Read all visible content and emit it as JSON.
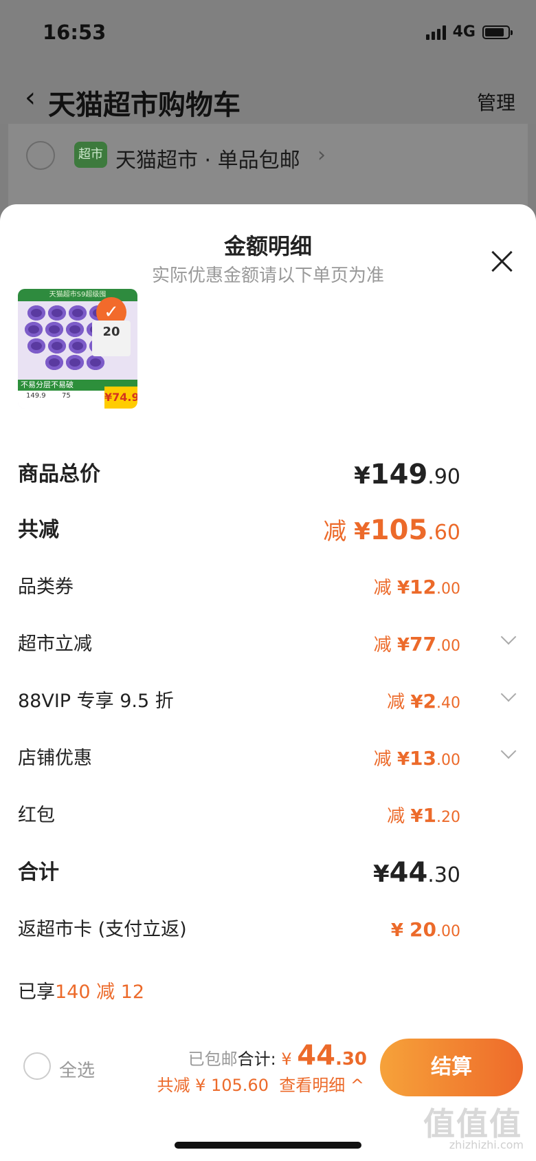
{
  "status_bar": {
    "time": "16:53",
    "network": "4G"
  },
  "nav": {
    "title": "天猫超市购物车",
    "manage": "管理"
  },
  "shop": {
    "badge": "超市",
    "name": "天猫超市 · 单品包邮"
  },
  "sheet": {
    "title": "金额明细",
    "subtitle": "实际优惠金额请以下单页为准",
    "product": {
      "banner": "天猫超市S9超级囤",
      "promo_line": "不易分层不易破",
      "original_price": "149.9",
      "discount_price": "75",
      "final_price": "¥74.9",
      "rebate": "20"
    },
    "rows": [
      {
        "label": "商品总价",
        "prefix": "",
        "yen": "¥",
        "int": "149",
        "dec": ".90",
        "style": "lg-dark",
        "chevron": false
      },
      {
        "label": "共减",
        "prefix": "减 ",
        "yen": "¥",
        "int": "105",
        "dec": ".60",
        "style": "lg-orange",
        "chevron": false
      },
      {
        "label": "品类券",
        "prefix": "减 ",
        "yen": "¥",
        "int": "12",
        "dec": ".00",
        "style": "md-orange",
        "chevron": false
      },
      {
        "label": "超市立减",
        "prefix": "减 ",
        "yen": "¥",
        "int": "77",
        "dec": ".00",
        "style": "md-orange",
        "chevron": true
      },
      {
        "label": "88VIP 专享 9.5 折",
        "prefix": "减 ",
        "yen": "¥",
        "int": "2",
        "dec": ".40",
        "style": "md-orange",
        "chevron": true
      },
      {
        "label": "店铺优惠",
        "prefix": "减 ",
        "yen": "¥",
        "int": "13",
        "dec": ".00",
        "style": "md-orange",
        "chevron": true
      },
      {
        "label": "红包",
        "prefix": "减 ",
        "yen": "¥",
        "int": "1",
        "dec": ".20",
        "style": "md-orange",
        "chevron": false
      },
      {
        "label": "合计",
        "prefix": "",
        "yen": "¥",
        "int": "44",
        "dec": ".30",
        "style": "lg-dark",
        "chevron": false
      },
      {
        "label": "返超市卡 (支付立返)",
        "prefix": "",
        "yen": "¥ ",
        "int": "20",
        "dec": ".00",
        "style": "md-orange-plain",
        "chevron": false
      }
    ],
    "enjoyed_label": "已享",
    "enjoyed_value": "140 减 12"
  },
  "footer": {
    "select_all": "全选",
    "shipping": "已包邮",
    "total_label": "合计:",
    "total_yen": "¥ ",
    "total_int": "44",
    "total_dec": ".30",
    "savings": "共减 ¥ 105.60",
    "detail_link": "查看明细 ^",
    "checkout": "结算"
  },
  "watermark": {
    "text": "值值值",
    "url": "zhizhizhi.com"
  },
  "colors": {
    "accent": "#ec6a2a",
    "overlay": "#808080",
    "green_badge": "#3d7a3d"
  }
}
